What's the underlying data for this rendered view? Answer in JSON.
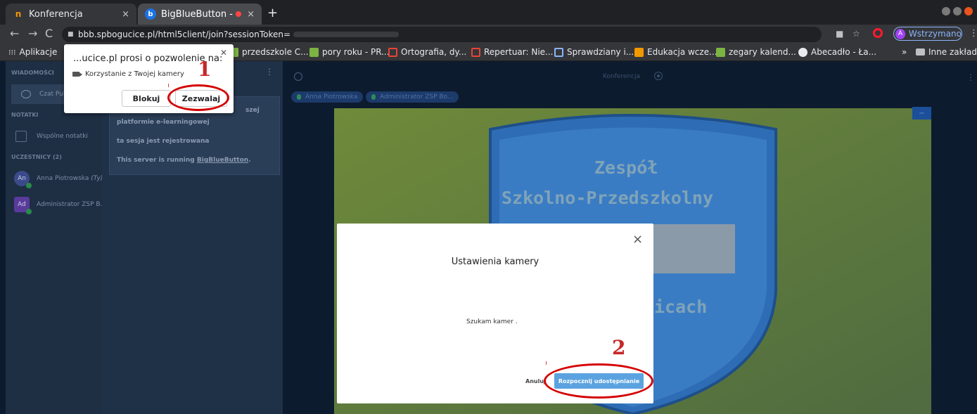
{
  "browser": {
    "tabs": [
      {
        "label": "Konferencja",
        "favicon": "n"
      },
      {
        "label": "BigBlueButton - Konfe",
        "favicon": "b"
      }
    ],
    "new_tab": "+",
    "url_host": "bbb.spbogucice.pl",
    "url_path": "/html5client/join?sessionToken=",
    "profile_initial": "A",
    "profile_label": "Wstrzymano",
    "bookmarks": [
      "Aplikacje",
      "przedszkole C...",
      "pory roku - PR...",
      "Ortografia, dy...",
      "Repertuar: Nie...",
      "Sprawdziany i...",
      "Edukacja wcze...",
      "zegary kalend...",
      "Abecadło - Ła...",
      "»",
      "Inne zakładki"
    ]
  },
  "permission_popup": {
    "title": "...ucice.pl prosi o pozwolenie na:",
    "item": "Korzystanie z Twojej kamery",
    "block_label": "Blokuj",
    "allow_label": "Zezwalaj"
  },
  "sidebar": {
    "messages_heading": "WIADOMOŚCI",
    "public_chat": "Czat Publi",
    "notes_heading": "NOTATKI",
    "shared_notes": "Wspólne notatki",
    "participants_heading": "UCZESTNICY (2)",
    "users": [
      {
        "initials": "An",
        "name": "Anna Piotrowska",
        "suffix": "(Ty)"
      },
      {
        "initials": "Ad",
        "name": "Administrator ZSP B...",
        "suffix": ""
      }
    ]
  },
  "chat": {
    "welcome_1": "szej",
    "welcome_2": "platformie e-learningowej",
    "welcome_3": "ta sesja jest rejestrowana",
    "welcome_4_prefix": "This server is running ",
    "welcome_4_link": "BigBlueButton",
    "welcome_4_suffix": "."
  },
  "main": {
    "title": "Konferencja",
    "talkers": [
      "Anna Piotrowska",
      "Administrator ZSP Bo..."
    ],
    "slide_button": "−",
    "slide_text_1": "Zespół",
    "slide_text_2": "Szkolno-Przedszkolny",
    "slide_text_3": "icach"
  },
  "camera_modal": {
    "title": "Ustawienia kamery",
    "status": "Szukam kamer .",
    "cancel_label": "Anuluj",
    "start_label": "Rozpocznij udostępnianie",
    "close_glyph": "×"
  },
  "annotations": {
    "step1": "1",
    "step2": "2",
    "color": "#d50000"
  },
  "icons": [
    "back-icon",
    "forward-icon",
    "reload-icon",
    "lock-icon",
    "camera-icon",
    "star-icon",
    "opera-icon",
    "apps-grid-icon",
    "folder-icon",
    "close-icon",
    "chat-icon",
    "notes-icon",
    "user-icon",
    "record-icon",
    "mic-icon",
    "kebab-icon"
  ]
}
